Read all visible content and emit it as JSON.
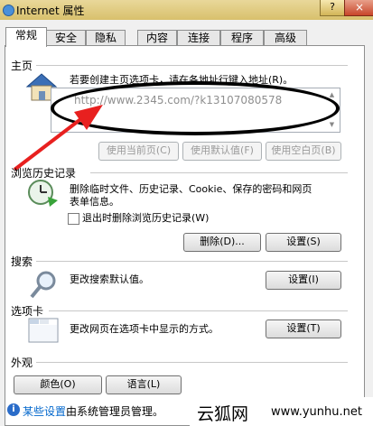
{
  "window": {
    "title": "Internet 属性",
    "help_glyph": "?",
    "close_glyph": "×"
  },
  "tabs": [
    {
      "label": "常规",
      "active": true
    },
    {
      "label": "安全"
    },
    {
      "label": "隐私"
    },
    {
      "label": "内容"
    },
    {
      "label": "连接"
    },
    {
      "label": "程序"
    },
    {
      "label": "高级"
    }
  ],
  "home": {
    "header": "主页",
    "description": "若要创建主页选项卡，请在各地址行键入地址(R)。",
    "url_value": "http://www.2345.com/?k13107080578",
    "buttons": {
      "current": "使用当前页(C)",
      "default": "使用默认值(F)",
      "blank": "使用空白页(B)"
    }
  },
  "history": {
    "header": "浏览历史记录",
    "description_line1": "删除临时文件、历史记录、Cookie、保存的密码和网页",
    "description_line2": "表单信息。",
    "checkbox_label": "退出时删除浏览历史记录(W)",
    "buttons": {
      "delete": "删除(D)...",
      "settings": "设置(S)"
    }
  },
  "search": {
    "header": "搜索",
    "description": "更改搜索默认值。",
    "settings_button": "设置(I)"
  },
  "tabs_section": {
    "header": "选项卡",
    "description": "更改网页在选项卡中显示的方式。",
    "settings_button": "设置(T)"
  },
  "appearance": {
    "header": "外观",
    "colors_button": "颜色(O)",
    "languages_button": "语言(L)"
  },
  "footer": {
    "link": "某些设置",
    "text": "由系统管理员管理。"
  },
  "watermark": {
    "cn": "云狐网",
    "en": "www.yunhu.net"
  },
  "colors": {
    "arrow": "#e8201f",
    "link": "#0066cc"
  }
}
